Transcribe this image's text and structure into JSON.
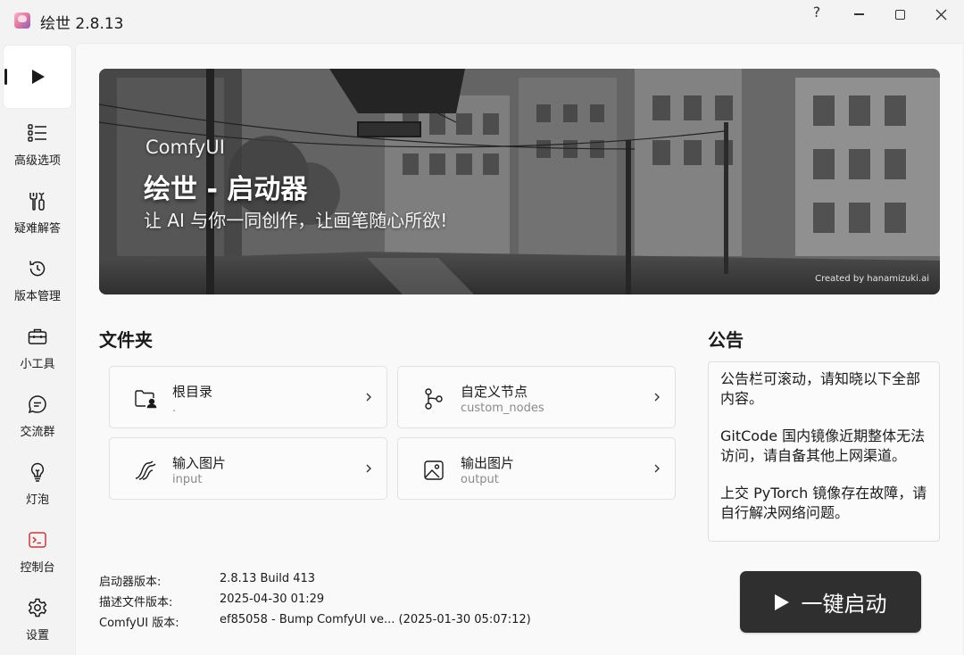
{
  "window": {
    "title": "绘世 2.8.13",
    "help_label": "?"
  },
  "sidebar": {
    "items": [
      {
        "label": "",
        "icon": "play-icon",
        "active": true
      },
      {
        "label": "高级选项",
        "icon": "list-icon"
      },
      {
        "label": "疑难解答",
        "icon": "tools-icon"
      },
      {
        "label": "版本管理",
        "icon": "history-icon"
      },
      {
        "label": "小工具",
        "icon": "toolbox-icon"
      },
      {
        "label": "交流群",
        "icon": "chat-icon"
      },
      {
        "label": "灯泡",
        "icon": "lightbulb-icon"
      },
      {
        "label": "控制台",
        "icon": "console-icon"
      },
      {
        "label": "设置",
        "icon": "gear-icon"
      }
    ]
  },
  "banner": {
    "subtitle": "ComfyUI",
    "title": "绘世 - 启动器",
    "tagline": "让 AI 与你一同创作，让画笔随心所欲!",
    "credit": "Created by hanamizuki.ai"
  },
  "folders": {
    "title": "文件夹",
    "items": [
      {
        "name": "根目录",
        "path": ".",
        "icon": "folder-icon"
      },
      {
        "name": "自定义节点",
        "path": "custom_nodes",
        "icon": "branch-icon"
      },
      {
        "name": "输入图片",
        "path": "input",
        "icon": "wave-icon"
      },
      {
        "name": "输出图片",
        "path": "output",
        "icon": "image-icon"
      }
    ]
  },
  "notice": {
    "title": "公告",
    "paragraphs": [
      "公告栏可滚动，请知晓以下全部内容。",
      "GitCode 国内镜像近期整体无法访问，请自备其他上网渠道。",
      "上交 PyTorch 镜像存在故障，请自行解决网络问题。"
    ]
  },
  "versions": [
    {
      "label": "启动器版本:",
      "value": "2.8.13 Build 413"
    },
    {
      "label": "描述文件版本:",
      "value": "2025-04-30 01:29"
    },
    {
      "label": "ComfyUI 版本:",
      "value": "ef85058 - Bump ComfyUI ve... (2025-01-30 05:07:12)"
    }
  ],
  "launch": {
    "label": "一键启动"
  },
  "colors": {
    "accent": "#2f2f2f",
    "console_icon": "#d13438"
  }
}
